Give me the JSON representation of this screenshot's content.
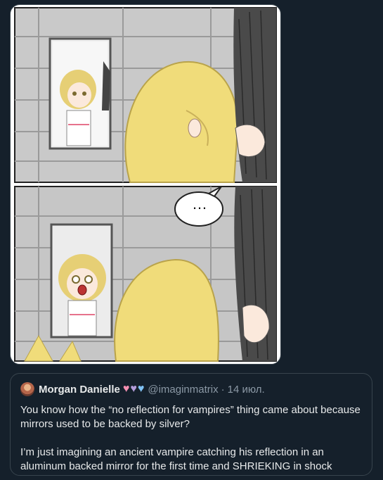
{
  "quoted_tweet": {
    "author_name": "Morgan Danielle",
    "handle": "@imaginmatrix",
    "separator": "·",
    "date": "14 июл.",
    "hearts": [
      {
        "glyph": "♥",
        "color": "#f48fb1"
      },
      {
        "glyph": "♥",
        "color": "#b39ddb"
      },
      {
        "glyph": "♥",
        "color": "#81c3f5"
      }
    ],
    "paragraphs": [
      "You know how the “no reflection for vampires” thing came about because mirrors used to be backed by silver?",
      "I’m just imagining an ancient vampire catching his reflection in an aluminum backed mirror for the first time and SHRIEKING in shock"
    ]
  },
  "comic": {
    "speech_bubble_text": "…"
  },
  "colors": {
    "background": "#15202b",
    "border": "#38444d",
    "text": "#e7e9ea",
    "muted": "#8b98a5"
  }
}
